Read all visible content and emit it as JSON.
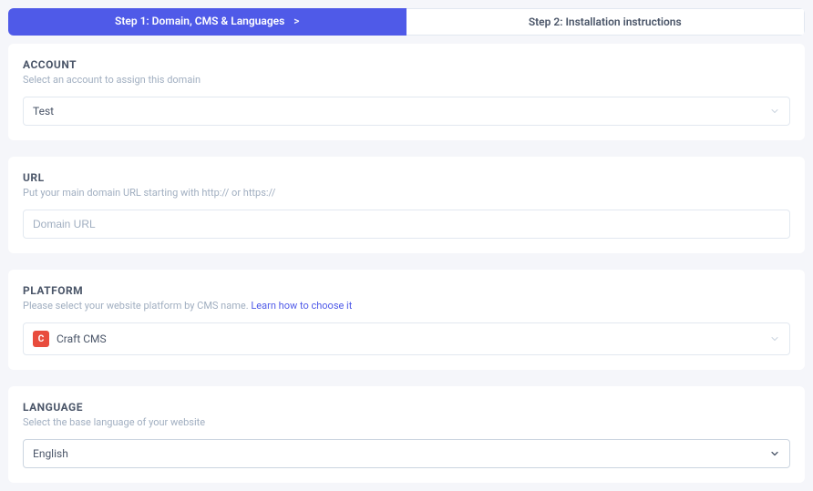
{
  "steps": {
    "step1": "Step 1: Domain, CMS & Languages",
    "step2": "Step 2: Installation instructions"
  },
  "account": {
    "title": "ACCOUNT",
    "desc": "Select an account to assign this domain",
    "value": "Test"
  },
  "url": {
    "title": "URL",
    "desc": "Put your main domain URL starting with http:// or https://",
    "placeholder": "Domain URL"
  },
  "platform": {
    "title": "PLATFORM",
    "desc_prefix": "Please select your website platform by CMS name. ",
    "link": "Learn how to choose it",
    "icon_letter": "C",
    "value": "Craft CMS"
  },
  "language": {
    "title": "LANGUAGE",
    "desc": "Select the base language of your website",
    "value": "English"
  }
}
